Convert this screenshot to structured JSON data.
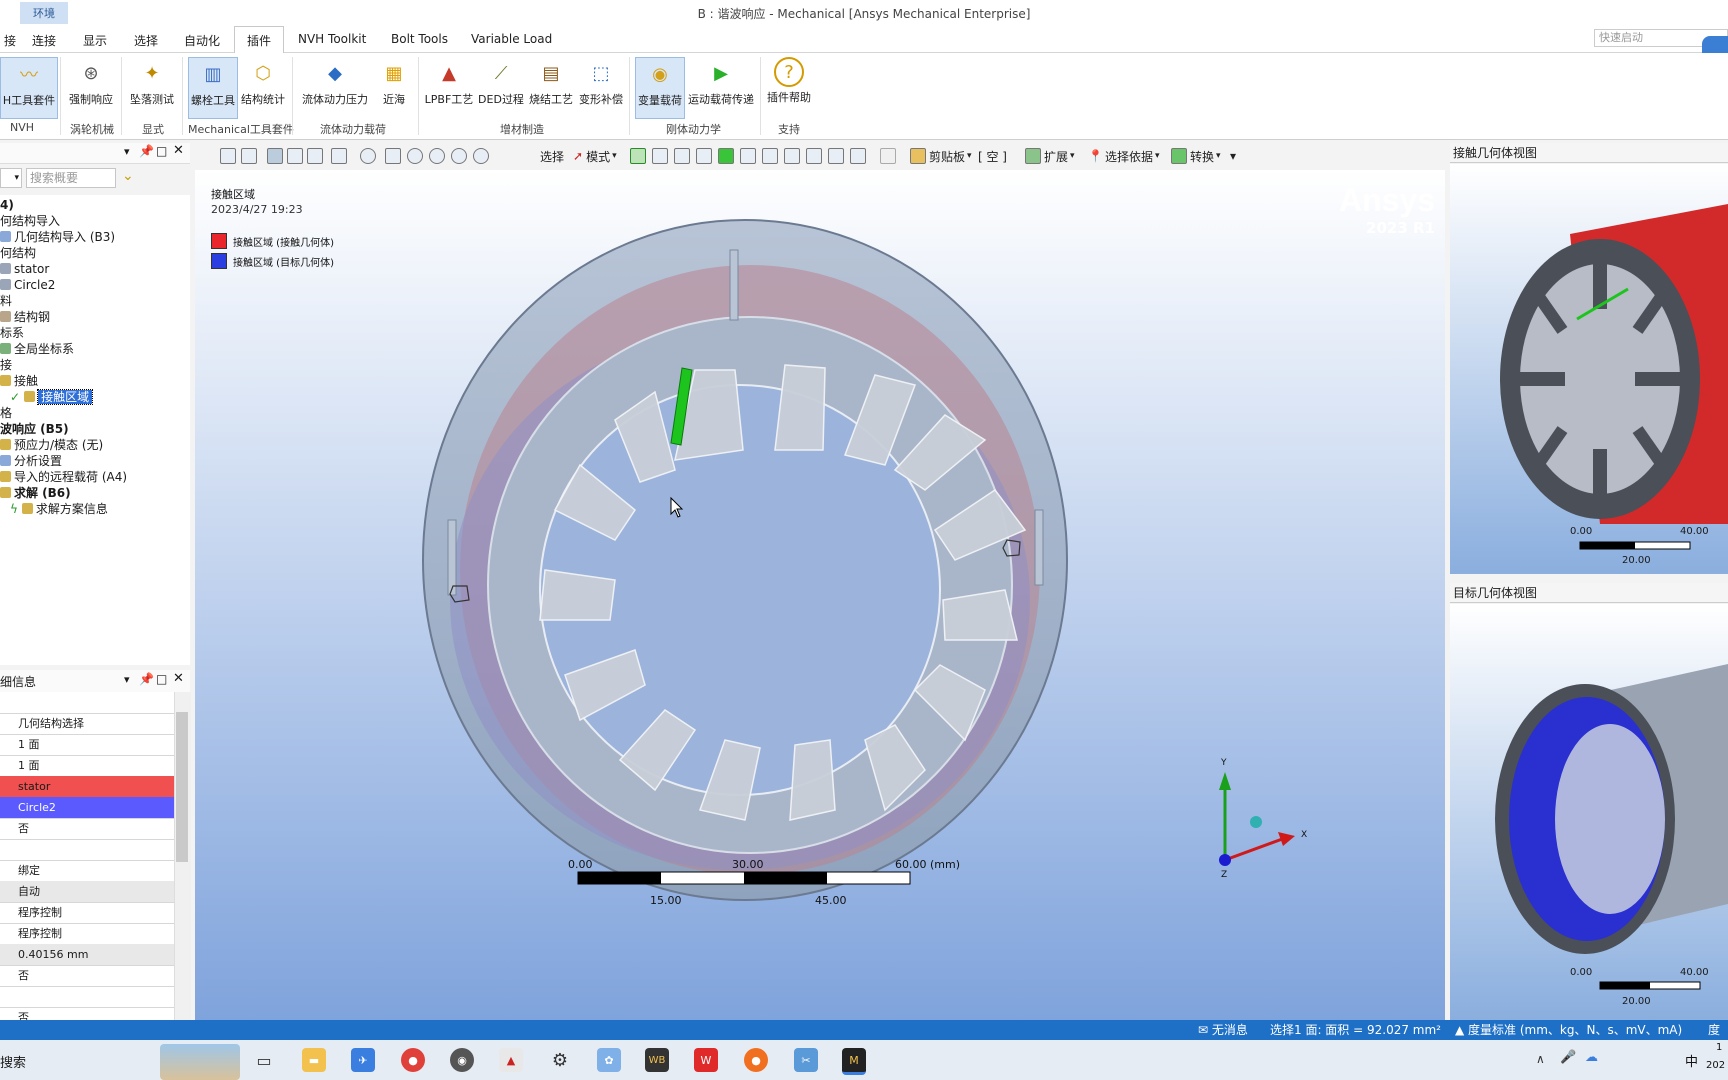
{
  "window": {
    "context_tab": "环境",
    "title": "B : 谐波响应 - Mechanical [Ansys Mechanical Enterprise]"
  },
  "menu": {
    "tabs": [
      "接",
      "连接",
      "显示",
      "选择",
      "自动化",
      "插件",
      "NVH Toolkit",
      "Bolt Tools",
      "Variable Load"
    ],
    "active": "插件",
    "quick_launch_placeholder": "快速启动"
  },
  "ribbon": {
    "buttons": [
      "H工具套件",
      "强制响应",
      "坠落测试",
      "螺栓工具",
      "结构统计",
      "流体动力压力",
      "近海",
      "LPBF工艺",
      "DED过程",
      "烧结工艺",
      "变形补偿",
      "变量载荷",
      "运动载荷传递",
      "插件帮助"
    ],
    "groups": [
      "NVH",
      "涡轮机械",
      "显式",
      "Mechanical工具套件",
      "流体动力载荷",
      "增材制造",
      "刚体动力学",
      "支持"
    ]
  },
  "view_toolbar": {
    "select": "选择",
    "mode": "模式",
    "clipboard": "剪贴板",
    "empty": "[ 空 ]",
    "extend": "扩展",
    "select_by": "选择依据",
    "convert": "转换"
  },
  "outline": {
    "search_placeholder": "搜索概要",
    "items": [
      {
        "text": "4)",
        "bold": true
      },
      {
        "text": "何结构导入",
        "bold": false
      },
      {
        "text": "几何结构导入 (B3)",
        "bold": false
      },
      {
        "text": "何结构",
        "bold": false
      },
      {
        "text": "stator",
        "bold": false
      },
      {
        "text": "Circle2",
        "bold": false
      },
      {
        "text": "料",
        "bold": false
      },
      {
        "text": "结构钢",
        "bold": false
      },
      {
        "text": "标系",
        "bold": false
      },
      {
        "text": "全局坐标系",
        "bold": false
      },
      {
        "text": "接",
        "bold": false
      },
      {
        "text": "接触",
        "bold": false
      },
      {
        "text": "接触区域",
        "bold": false
      },
      {
        "text": "格",
        "bold": false
      },
      {
        "text": "波响应 (B5)",
        "bold": true
      },
      {
        "text": "预应力/模态 (无)",
        "bold": false
      },
      {
        "text": "分析设置",
        "bold": false
      },
      {
        "text": "导入的远程载荷 (A4)",
        "bold": false
      },
      {
        "text": "求解 (B6)",
        "bold": true
      },
      {
        "text": "求解方案信息",
        "bold": false
      }
    ]
  },
  "details": {
    "title": "细信息",
    "rows": [
      "",
      "几何结构选择",
      "1 面",
      "1 面",
      "stator",
      "Circle2",
      "否",
      "",
      "绑定",
      "自动",
      "程序控制",
      "程序控制",
      "0.40156 mm",
      "否",
      "",
      "否"
    ]
  },
  "viewport": {
    "title": "接触区域",
    "date": "2023/4/27 19:23",
    "legend": [
      {
        "label": "接触区域 (接触几何体)",
        "color": "#e8262b"
      },
      {
        "label": "接触区域 (目标几何体)",
        "color": "#2b3fe0"
      }
    ],
    "brand": "Ansys",
    "version": "2023 R1",
    "scale_top": [
      "0.00",
      "30.00",
      "60.00 (mm)"
    ],
    "scale_bottom": [
      "15.00",
      "45.00"
    ],
    "axes": [
      "Y",
      "X",
      "Z"
    ]
  },
  "contact_view": {
    "title": "接触几何体视图",
    "scale_top": [
      "0.00",
      "40.00"
    ],
    "scale_bottom": "20.00"
  },
  "target_view": {
    "title": "目标几何体视图",
    "scale_top": [
      "0.00",
      "40.00"
    ],
    "scale_bottom": "20.00"
  },
  "status": {
    "messages": "无消息",
    "selection": "选择1 面: 面积 = 92.027 mm²",
    "units": "度量标准 (mm、kg、N、s、mV、mA)",
    "angle": "度"
  },
  "taskbar": {
    "search": "搜索",
    "apps": [
      "task-view",
      "file-explorer",
      "feishu",
      "chrome",
      "wechat",
      "ansys-workbench",
      "settings",
      "onedrive",
      "wb",
      "wps",
      "recorder",
      "snipping",
      "mechanical"
    ],
    "tray_ime": "中",
    "clock_time": "1",
    "clock_date": "202"
  }
}
